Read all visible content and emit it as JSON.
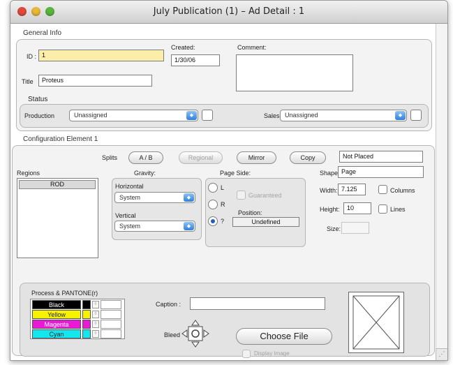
{
  "window": {
    "title": "July Publication (1) – Ad Detail : 1"
  },
  "traffic_lights": [
    {
      "name": "close",
      "color": "#e04a3c"
    },
    {
      "name": "minimize",
      "color": "#e8b83a"
    },
    {
      "name": "zoom",
      "color": "#5ab63e"
    }
  ],
  "general": {
    "section_label": "General Info",
    "id_label": "ID :",
    "id_value": "1",
    "created_label": "Created:",
    "created_value": "1/30/06",
    "comment_label": "Comment:",
    "comment_value": "",
    "title_label": "Title",
    "title_value": "Proteus",
    "status_label": "Status",
    "production_label": "Production",
    "production_value": "Unassigned",
    "sales_label": "Sales",
    "sales_value": "Unassigned"
  },
  "config": {
    "section_label": "Configuration Element 1",
    "splits_label": "Splits",
    "ab_button": "A / B",
    "regional_button": "Regional",
    "mirror_button": "Mirror",
    "copy_button": "Copy",
    "placed_status": "Not Placed",
    "regions_label": "Regions",
    "regions": [
      "ROD"
    ],
    "gravity_label": "Gravity:",
    "horizontal_label": "Horizontal",
    "horizontal_value": "System",
    "vertical_label": "Vertical",
    "vertical_value": "System",
    "page_side_label": "Page Side:",
    "side_options": [
      "L",
      "R",
      "?"
    ],
    "guaranteed_label": "Guaranteed",
    "position_label": "Position:",
    "position_value": "Undefined",
    "shape_label": "Shape",
    "shape_value": "Page",
    "width_label": "Width:",
    "width_value": "7.125",
    "columns_label": "Columns",
    "height_label": "Height:",
    "height_value": "10",
    "lines_label": "Lines",
    "size_label": "Size:",
    "size_value": ""
  },
  "process": {
    "section_label": "Process & PANTONE(r)",
    "colors": [
      {
        "name": "Black",
        "bg": "#000000",
        "fg": "#ffffff"
      },
      {
        "name": "Yellow",
        "bg": "#f7f200",
        "fg": "#222222"
      },
      {
        "name": "Magenta",
        "bg": "#ec18d8",
        "fg": "#ffffff"
      },
      {
        "name": "Cyan",
        "bg": "#12e6ef",
        "fg": "#222222"
      }
    ],
    "caption_label": "Caption :",
    "caption_value": "",
    "bleed_label": "Bleed",
    "choose_file_button": "Choose File",
    "display_image_label": "Display Image"
  }
}
